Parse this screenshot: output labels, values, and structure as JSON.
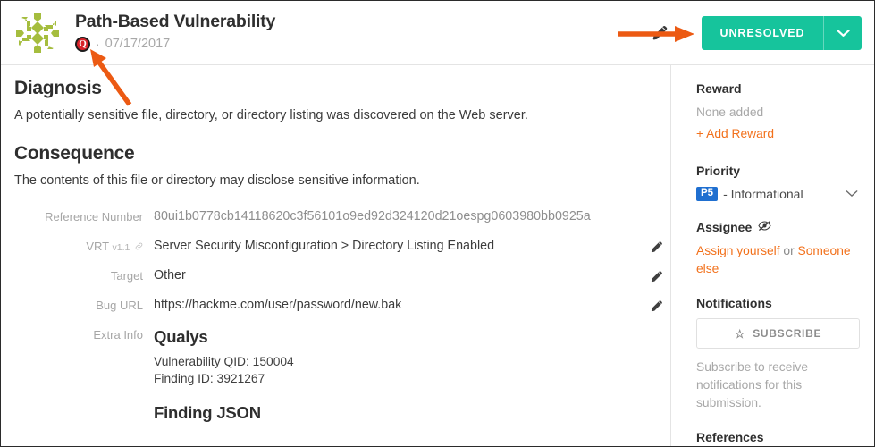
{
  "header": {
    "avatar_name": "qualys-logo-avatar",
    "title": "Path-Based Vulnerability",
    "source_badge": "Q",
    "meta_separator": "·",
    "date": "07/17/2017",
    "edit_icon": "pencil-icon",
    "status": {
      "label": "UNRESOLVED",
      "caret_icon": "chevron-down-icon",
      "color": "#16c49c"
    }
  },
  "main": {
    "diagnosis": {
      "heading": "Diagnosis",
      "text": "A potentially sensitive file, directory, or directory listing was discovered on the Web server."
    },
    "consequence": {
      "heading": "Consequence",
      "text": "The contents of this file or directory may disclose sensitive information."
    },
    "details": [
      {
        "label": "Reference Number",
        "value": "80ui1b0778cb14118620c3f56101o9ed92d324120d21oespg0603980bb0925a",
        "editable": false,
        "muted": true
      },
      {
        "label": "VRT",
        "version": "v1.1",
        "link_icon": "link-icon",
        "value": "Server Security Misconfiguration > Directory Listing Enabled",
        "editable": true,
        "muted": false
      },
      {
        "label": "Target",
        "value": "Other",
        "editable": true,
        "muted": false
      },
      {
        "label": "Bug URL",
        "value": "https://hackme.com/user/password/new.bak",
        "editable": true,
        "muted": false
      }
    ],
    "extra_info": {
      "label": "Extra Info",
      "title": "Qualys",
      "lines": [
        "Vulnerability QID: 150004",
        "Finding ID: 3921267"
      ],
      "finding_json_heading": "Finding JSON"
    }
  },
  "sidebar": {
    "reward": {
      "heading": "Reward",
      "value": "None added",
      "add_link": "+ Add Reward"
    },
    "priority": {
      "heading": "Priority",
      "badge": "P5",
      "text": "- Informational",
      "caret_icon": "chevron-down-icon",
      "badge_color": "#1f6fd0"
    },
    "assignee": {
      "heading": "Assignee",
      "visibility_icon": "eye-slash-icon",
      "self_link": "Assign yourself",
      "conjunction": " or ",
      "other_link": "Someone else"
    },
    "notifications": {
      "heading": "Notifications",
      "subscribe_icon": "star-icon",
      "subscribe_label": "SUBSCRIBE",
      "description": "Subscribe to receive notifications for this submission."
    },
    "references": {
      "heading": "References"
    }
  },
  "annotations": {
    "accent_color": "#ec5a13",
    "arrow_to_status": "arrow-right-pointing-at-status-button",
    "arrow_to_badge": "arrow-pointing-at-source-badge"
  }
}
